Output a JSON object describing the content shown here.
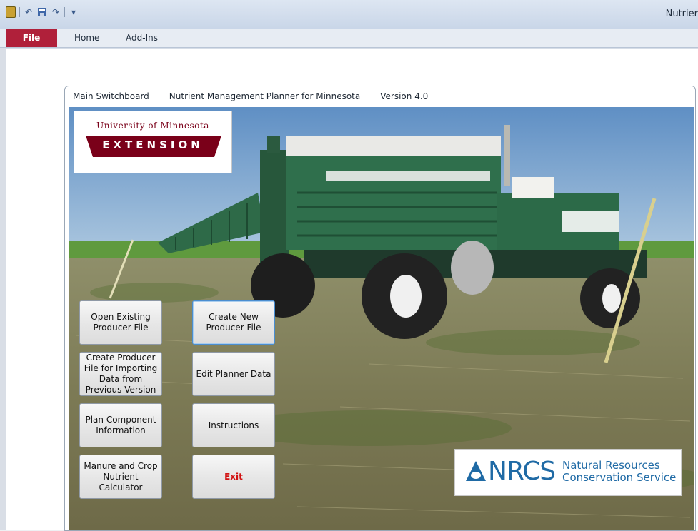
{
  "window": {
    "title": "Nutrier"
  },
  "ribbon": {
    "tabs": [
      {
        "label": "File"
      },
      {
        "label": "Home"
      },
      {
        "label": "Add-Ins"
      }
    ]
  },
  "form": {
    "caption_parts": [
      "Main Switchboard",
      "Nutrient Management Planner for Minnesota",
      "Version 4.0"
    ]
  },
  "logos": {
    "umn_line1": "University of Minnesota",
    "umn_line2": "EXTENSION",
    "nrcs_abbr": "NRCS",
    "nrcs_line1": "Natural Resources",
    "nrcs_line2": "Conservation Service"
  },
  "buttons": {
    "open_existing": "Open Existing Producer File",
    "create_new": "Create New Producer File",
    "create_import": "Create Producer File for Importing Data from Previous Version",
    "edit_planner": "Edit Planner Data",
    "plan_component": "Plan Component Information",
    "instructions": "Instructions",
    "manure_calc": "Manure and Crop Nutrient  Calculator",
    "exit": "Exit"
  },
  "colors": {
    "file_tab": "#b0203a",
    "umn_maroon": "#7a0019",
    "nrcs_blue": "#1f6aa5",
    "exit_text": "#d21212"
  },
  "icons": [
    "app-icon",
    "undo-icon",
    "save-icon",
    "redo-icon",
    "customize-qat-icon",
    "nrcs-drop-icon"
  ]
}
